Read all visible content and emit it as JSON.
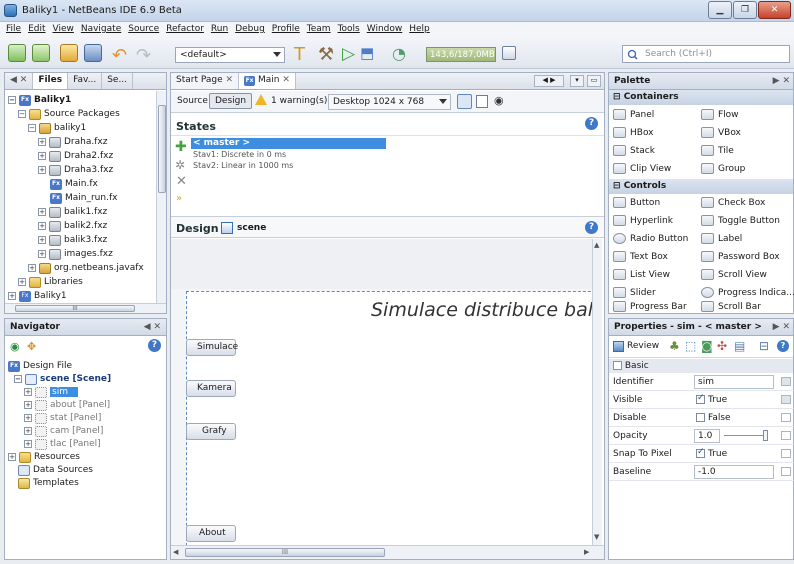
{
  "window": {
    "title": "Baliky1 - NetBeans IDE 6.9 Beta"
  },
  "menu": [
    "File",
    "Edit",
    "View",
    "Navigate",
    "Source",
    "Refactor",
    "Run",
    "Debug",
    "Profile",
    "Team",
    "Tools",
    "Window",
    "Help"
  ],
  "toolbar": {
    "config_combo": "<default>",
    "memory": "143,6/187,0MB",
    "search_placeholder": "Search (Ctrl+I)"
  },
  "projects_panel": {
    "tabs": [
      "Files",
      "Fav...",
      "Se..."
    ],
    "tree": [
      {
        "label": "Baliky1",
        "bold": true
      },
      {
        "label": "Source Packages"
      },
      {
        "label": "baliky1"
      },
      {
        "label": "Draha.fxz"
      },
      {
        "label": "Draha2.fxz"
      },
      {
        "label": "Draha3.fxz"
      },
      {
        "label": "Main.fx"
      },
      {
        "label": "Main_run.fx"
      },
      {
        "label": "balik1.fxz"
      },
      {
        "label": "balik2.fxz"
      },
      {
        "label": "balik3.fxz"
      },
      {
        "label": "images.fxz"
      },
      {
        "label": "org.netbeans.javafx"
      },
      {
        "label": "Libraries"
      },
      {
        "label": "Baliky1"
      }
    ],
    "scroll_h": "III"
  },
  "navigator": {
    "title": "Navigator",
    "tree": [
      {
        "label": "Design File"
      },
      {
        "label": "scene [Scene]"
      },
      {
        "label": "sim"
      },
      {
        "label": "about [Panel]"
      },
      {
        "label": "stat [Panel]"
      },
      {
        "label": "cam [Panel]"
      },
      {
        "label": "tlac [Panel]"
      },
      {
        "label": "Resources"
      },
      {
        "label": "Data Sources"
      },
      {
        "label": "Templates"
      }
    ]
  },
  "editor": {
    "tabs": [
      "Start Page",
      "Main"
    ],
    "source_btn": "Source",
    "design_btn": "Design",
    "warning": "1 warning(s)",
    "resolution": "Desktop 1024 x 768",
    "states_title": "States",
    "states": [
      {
        "label": "< master >"
      },
      {
        "label": "Stav1: Discrete in 0 ms"
      },
      {
        "label": "Stav2: Linear in 1000 ms"
      }
    ],
    "design_title": "Design",
    "design_scene": "scene",
    "canvas_heading": "Simulace distribuce balí",
    "buttons": [
      "Simulace",
      "Kamera",
      "Grafy",
      "About"
    ],
    "scroll_h": "III"
  },
  "palette": {
    "title": "Palette",
    "containers_title": "Containers",
    "containers": [
      "Panel",
      "Flow",
      "HBox",
      "VBox",
      "Stack",
      "Tile",
      "Clip View",
      "Group"
    ],
    "controls_title": "Controls",
    "controls": [
      "Button",
      "Check Box",
      "Hyperlink",
      "Toggle Button",
      "Radio Button",
      "Label",
      "Text Box",
      "Password Box",
      "List View",
      "Scroll View",
      "Slider",
      "Progress Indica...",
      "Progress Bar",
      "Scroll Bar"
    ]
  },
  "properties": {
    "title": "Properties - sim - < master >",
    "review": "Review",
    "section": "Basic",
    "rows": [
      {
        "key": "Identifier",
        "value": "sim"
      },
      {
        "key": "Visible",
        "value": "True"
      },
      {
        "key": "Disable",
        "value": "False"
      },
      {
        "key": "Opacity",
        "value": "1.0"
      },
      {
        "key": "Snap To Pixel",
        "value": "True"
      },
      {
        "key": "Baseline",
        "value": "-1.0"
      }
    ]
  },
  "colors": {
    "accent": "#3d8ee0",
    "selection": "#2f7fd6",
    "canvas_dash": "#5c8ac4"
  }
}
